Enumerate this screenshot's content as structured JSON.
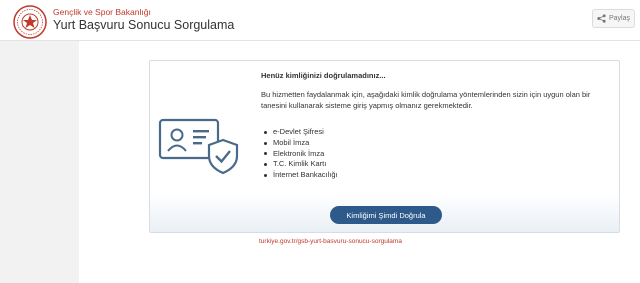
{
  "header": {
    "ministry_name": "Gençlik ve Spor Bakanlığı",
    "app_title": "Yurt Başvuru Sonucu Sorgulama",
    "share_label": "Paylaş",
    "logo_icon": "gsb-emblem-icon",
    "accent_color": "#c0392b"
  },
  "notice": {
    "title": "Henüz kimliğinizi doğrulamadınız...",
    "description": "Bu hizmetten faydalanmak için, aşağıdaki kimlik doğrulama yöntemlerinden sizin için uygun olan bir tanesini kullanarak sisteme giriş yapmış olmanız gerekmektedir.",
    "methods": [
      "e-Devlet Şifresi",
      "Mobil İmza",
      "Elektronik İmza",
      "T.C. Kimlik Kartı",
      "İnternet Bankacılığı"
    ],
    "verify_button_label": "Kimliğimi Şimdi Doğrula",
    "icon": "id-card-shield-icon",
    "button_color": "#2d5a8a"
  },
  "watermark_url": "turkiye.gov.tr/gsb-yurt-basvuru-sonucu-sorgulama"
}
